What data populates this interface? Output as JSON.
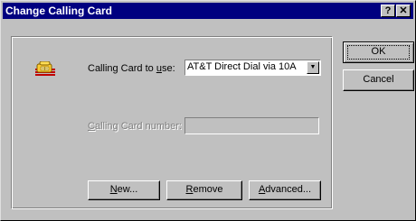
{
  "window": {
    "title": "Change Calling Card",
    "help_glyph": "?",
    "close_glyph": "✕"
  },
  "form": {
    "card_label_pre": "Calling Card to ",
    "card_label_key": "u",
    "card_label_post": "se:",
    "card_value": "AT&T Direct Dial via 10A",
    "number_label_key": "C",
    "number_label_post": "alling Card number:",
    "number_value": ""
  },
  "buttons": {
    "ok": "OK",
    "cancel": "Cancel",
    "new_key": "N",
    "new_post": "ew...",
    "remove_key": "R",
    "remove_post": "emove",
    "advanced_key": "A",
    "advanced_post": "dvanced..."
  },
  "icons": {
    "card_icon": "telephone-icon",
    "combo_arrow": "chevron-down-icon"
  },
  "colors": {
    "titlebar": "#000080",
    "face": "#c0c0c0"
  }
}
